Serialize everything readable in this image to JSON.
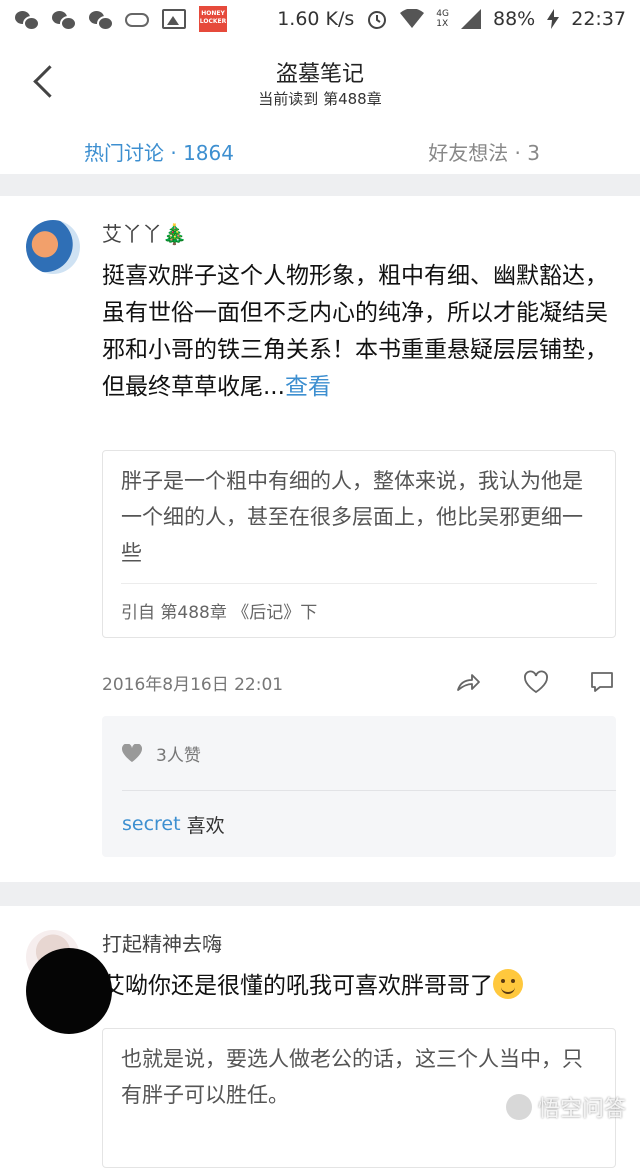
{
  "status_bar": {
    "speed": "1.60 K/s",
    "net_top": "4G",
    "net_bottom": "1X",
    "battery": "88%",
    "time": "22:37",
    "icons": [
      "wechat-icon",
      "wechat-icon",
      "wechat-icon",
      "cloud-icon",
      "image-icon",
      "honey-app-icon",
      "alarm-icon",
      "wifi-icon",
      "signal-icon",
      "charging-icon"
    ]
  },
  "header": {
    "title": "盗墓笔记",
    "subtitle": "当前读到 第488章",
    "back_icon": "chevron-left-icon"
  },
  "tabs": {
    "hot": "热门讨论 · 1864",
    "friends": "好友想法 · 3"
  },
  "colors": {
    "accent": "#3d8fd0",
    "divider": "#eeeff1"
  },
  "comments": [
    {
      "user": "艾丫丫",
      "user_suffix": "🎄",
      "text": "挺喜欢胖子这个人物形象，粗中有细、幽默豁达，虽有世俗一面但不乏内心的纯净，所以才能凝结吴邪和小哥的铁三角关系！本书重重悬疑层层铺垫，但最终草草收尾...",
      "more": "查看",
      "quote": "胖子是一个粗中有细的人，整体来说，我认为他是一个细的人，甚至在很多层面上，他比吴邪更细一些",
      "quote_source": "引自 第488章 《后记》下",
      "time": "2016年8月16日 22:01",
      "likes": "3人赞",
      "liked_user": "secret",
      "liked_suffix": "喜欢"
    },
    {
      "user": "打起精神去嗨",
      "text": "艾呦你还是很懂的吼我可喜欢胖哥哥了",
      "quote": "也就是说，要选人做老公的话，这三个人当中，只有胖子可以胜任。"
    }
  ],
  "watermark": "悟空问答"
}
